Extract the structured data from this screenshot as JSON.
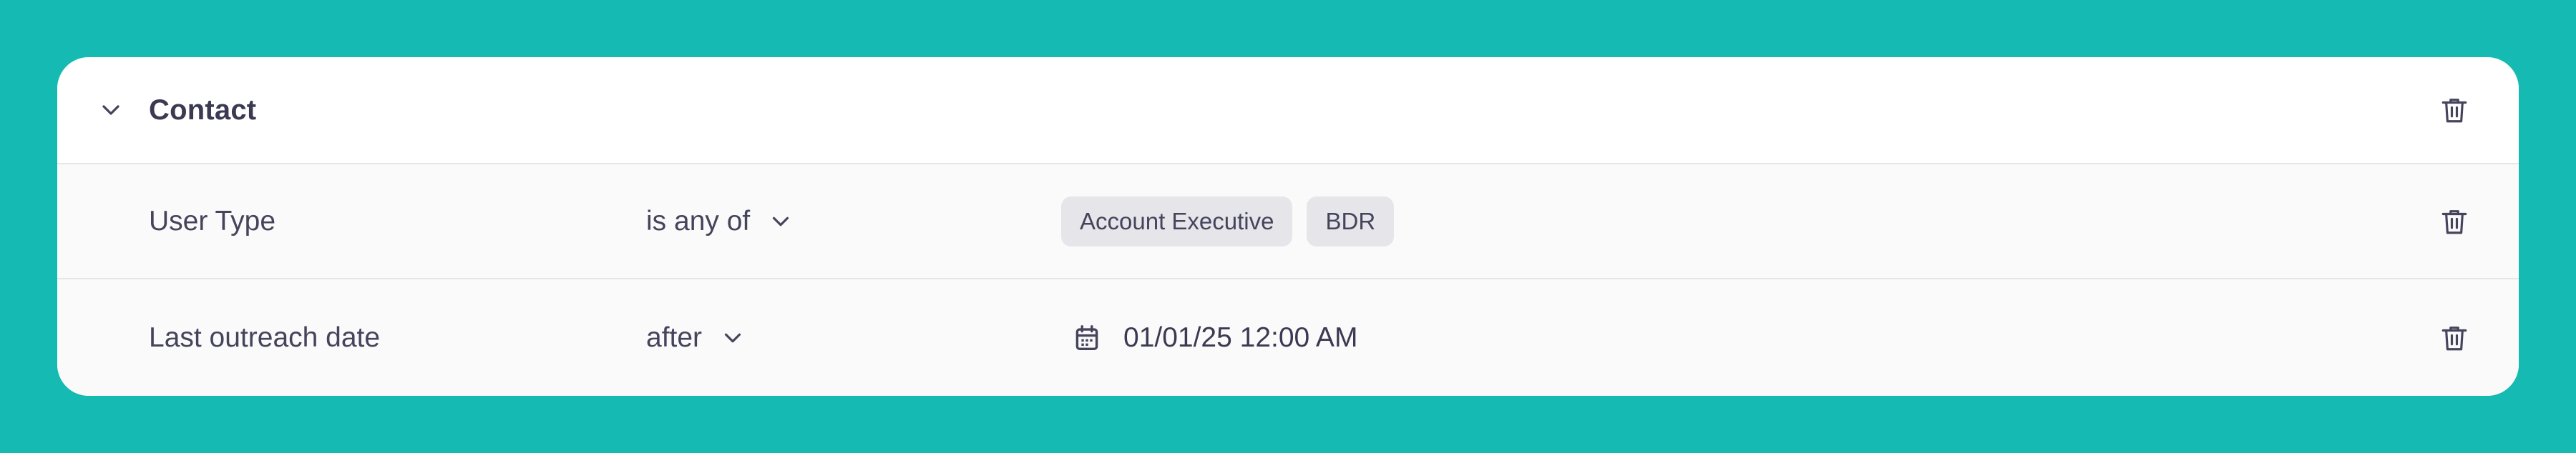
{
  "group": {
    "title": "Contact",
    "expanded": true,
    "toggle_icon": "chevron-down-icon",
    "delete_icon": "trash-icon"
  },
  "conditions": [
    {
      "field": "User Type",
      "operator": "is any of",
      "values": [
        "Account Executive",
        "BDR"
      ]
    },
    {
      "field": "Last outreach date",
      "operator": "after",
      "date_icon": "calendar-icon",
      "value": "01/01/25 12:00 AM"
    }
  ],
  "colors": {
    "background": "#15bbb3",
    "card": "#ffffff",
    "row_background": "#fafafa",
    "tag_background": "#e6e6ea",
    "text": "#45445c"
  }
}
